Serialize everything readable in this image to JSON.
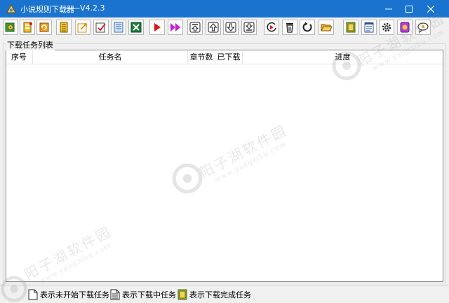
{
  "window": {
    "title": "小说规则下载器",
    "version": "——V4.2.3"
  },
  "toolbar": {
    "buttons": [
      {
        "icon": "gear-add-icon"
      },
      {
        "icon": "book-import-icon"
      },
      {
        "icon": "refresh-book-icon"
      },
      {
        "icon": "book-list-icon"
      },
      {
        "icon": "link-edit-icon"
      },
      {
        "icon": "checklist-icon"
      },
      {
        "icon": "notebook-icon"
      },
      {
        "icon": "excel-export-icon"
      },
      {
        "icon": "play-icon"
      },
      {
        "icon": "fast-forward-icon"
      },
      {
        "icon": "move-top-icon"
      },
      {
        "icon": "move-up-icon"
      },
      {
        "icon": "move-down-icon"
      },
      {
        "icon": "move-bottom-icon"
      },
      {
        "icon": "resume-icon"
      },
      {
        "icon": "delete-icon"
      },
      {
        "icon": "reset-icon"
      },
      {
        "icon": "open-folder-icon"
      },
      {
        "icon": "book-icon"
      },
      {
        "icon": "notes-icon"
      },
      {
        "icon": "settings-icon"
      },
      {
        "icon": "plugin-icon"
      },
      {
        "icon": "comment-icon"
      }
    ]
  },
  "task_list": {
    "group_title": "下载任务列表",
    "columns": [
      "序号",
      "任务名",
      "章节数",
      "已下载",
      "进度"
    ],
    "rows": []
  },
  "legend": {
    "not_started": "表示未开始下载任务",
    "downloading": "表示下载中任务",
    "finished": "表示下载完成任务"
  },
  "watermark": {
    "site_cn": "阳子湖软件园",
    "site_url": "www.yangzihu.com"
  },
  "colors": {
    "titlebar": "#1a73cf",
    "play_red": "#d8161b",
    "forward_magenta": "#c21ed6"
  }
}
